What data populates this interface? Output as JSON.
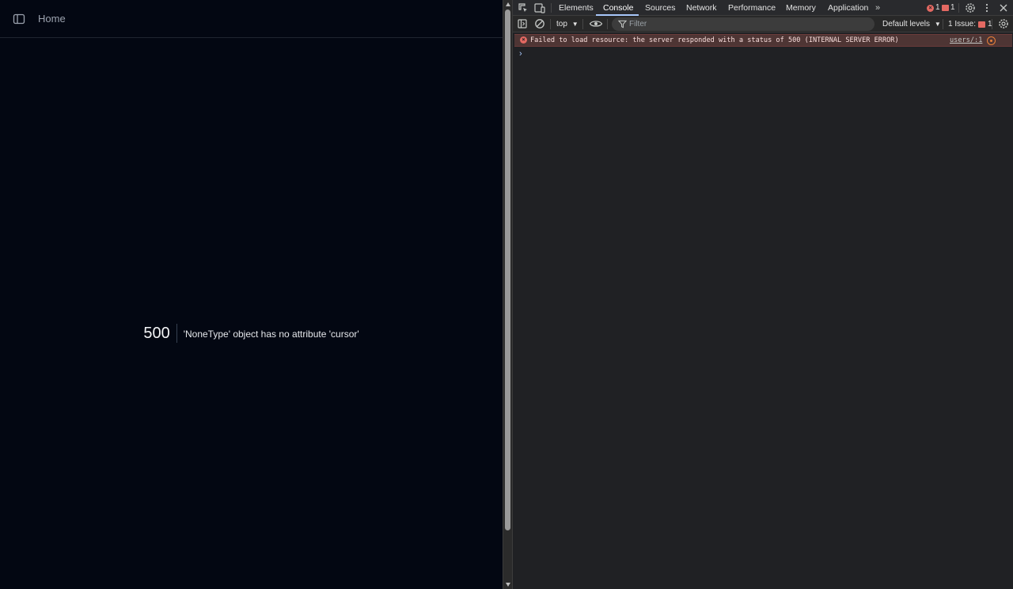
{
  "app": {
    "breadcrumb": "Home",
    "error": {
      "code": "500",
      "message": "'NoneType' object has no attribute 'cursor'"
    }
  },
  "devtools": {
    "tabs": [
      "Elements",
      "Console",
      "Sources",
      "Network",
      "Performance",
      "Memory",
      "Application"
    ],
    "active_tab": "Console",
    "overflow_label": "»",
    "error_count": "1",
    "warning_count": "1",
    "toolbar": {
      "context": "top",
      "filter_placeholder": "Filter",
      "levels": "Default levels",
      "issues_label": "1 Issue:",
      "issues_count": "1"
    },
    "console": {
      "error_message": "Failed to load resource: the server responded with a status of 500 (INTERNAL SERVER ERROR)",
      "error_source": "users/:1",
      "prompt": "›"
    }
  },
  "colors": {
    "app_bg": "#030712",
    "devtools_bg": "#202124",
    "error_row_bg": "#4e3534",
    "error_accent": "#e46962",
    "active_tab_accent": "#a8c7fa"
  }
}
